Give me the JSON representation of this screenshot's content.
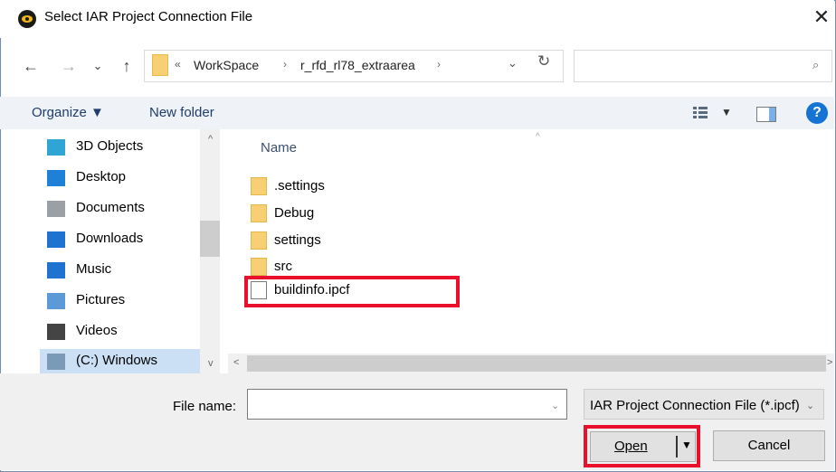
{
  "window": {
    "title": "Select IAR Project Connection File",
    "close_glyph": "✕"
  },
  "address_bar": {
    "back_glyph": "←",
    "forward_glyph": "→",
    "recent_glyph": "⌄",
    "up_glyph": "↑",
    "overflow_glyph": "«",
    "breadcrumb": [
      "WorkSpace",
      "r_rfd_rl78_extraarea"
    ],
    "separator_glyph": "›",
    "dropdown_glyph": "⌄",
    "refresh_glyph": "↻",
    "search_placeholder": "",
    "search_glyph": "⌕"
  },
  "toolbar": {
    "organize_label": "Organize ▼",
    "new_folder_label": "New folder",
    "view_drop_glyph": "▼",
    "help_glyph": "?"
  },
  "nav_pane": {
    "scroll_up": "^",
    "scroll_down": "v",
    "items": [
      {
        "label": "3D Objects",
        "icon": "3d-objects-icon",
        "color": "#2fa5d6"
      },
      {
        "label": "Desktop",
        "icon": "desktop-icon",
        "color": "#1e80d6"
      },
      {
        "label": "Documents",
        "icon": "documents-icon",
        "color": "#9aa0a6"
      },
      {
        "label": "Downloads",
        "icon": "downloads-icon",
        "color": "#1e73d0"
      },
      {
        "label": "Music",
        "icon": "music-icon",
        "color": "#1e73d0"
      },
      {
        "label": "Pictures",
        "icon": "pictures-icon",
        "color": "#5b9ad6"
      },
      {
        "label": "Videos",
        "icon": "videos-icon",
        "color": "#444444"
      },
      {
        "label": "(C:) Windows",
        "icon": "drive-icon",
        "color": "#7a9ab8"
      }
    ],
    "selected_index": 7
  },
  "file_list": {
    "column_name": "Name",
    "sort_glyph": "^",
    "scroll_left": "<",
    "scroll_right": ">",
    "items": [
      {
        "name": ".settings",
        "type": "folder"
      },
      {
        "name": "Debug",
        "type": "folder"
      },
      {
        "name": "settings",
        "type": "folder"
      },
      {
        "name": "src",
        "type": "folder"
      },
      {
        "name": "buildinfo.ipcf",
        "type": "file",
        "highlighted": true
      }
    ]
  },
  "bottom_bar": {
    "file_name_label": "File name:",
    "file_name_value": "",
    "file_name_drop": "⌄",
    "filter_value": "IAR Project Connection File (*.ipcf)",
    "filter_drop": "⌄",
    "open_label": "Open",
    "open_drop": "▼",
    "cancel_label": "Cancel"
  },
  "colors": {
    "highlight": "#e8102a",
    "selection": "#cce0f5",
    "toolbar_bg": "#eff2f6",
    "folder": "#f7d074"
  }
}
